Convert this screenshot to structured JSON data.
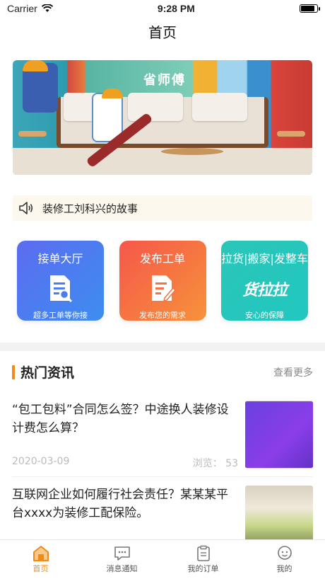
{
  "status": {
    "carrier": "Carrier",
    "time": "9:28 PM"
  },
  "nav": {
    "title": "首页"
  },
  "banner": {
    "brand": "省师傅"
  },
  "notice": {
    "text": "装修工刘科兴的故事"
  },
  "cards": [
    {
      "title": "接单大厅",
      "sub": "超多工单等你接",
      "icon": "search-document-icon"
    },
    {
      "title": "发布工单",
      "sub": "发布您的需求",
      "icon": "edit-document-icon"
    },
    {
      "title": "拉货|搬家|发整车",
      "sub": "安心的保障",
      "logo": "货拉拉"
    }
  ],
  "section": {
    "title": "热门资讯",
    "more": "查看更多"
  },
  "news": [
    {
      "title": "“包工包料”合同怎么签？中途换人装修设计费怎么算？",
      "date": "2020-03-09",
      "views": "浏览：  53"
    },
    {
      "title": "互联网企业如何履行社会责任？某某某平台xxxx为装修工配保险。"
    }
  ],
  "tabs": [
    {
      "label": "首页",
      "icon": "home-icon",
      "active": true
    },
    {
      "label": "消息通知",
      "icon": "message-icon"
    },
    {
      "label": "我的订单",
      "icon": "clipboard-icon"
    },
    {
      "label": "我的",
      "icon": "profile-icon"
    }
  ],
  "colors": {
    "accent": "#f08b1a"
  }
}
